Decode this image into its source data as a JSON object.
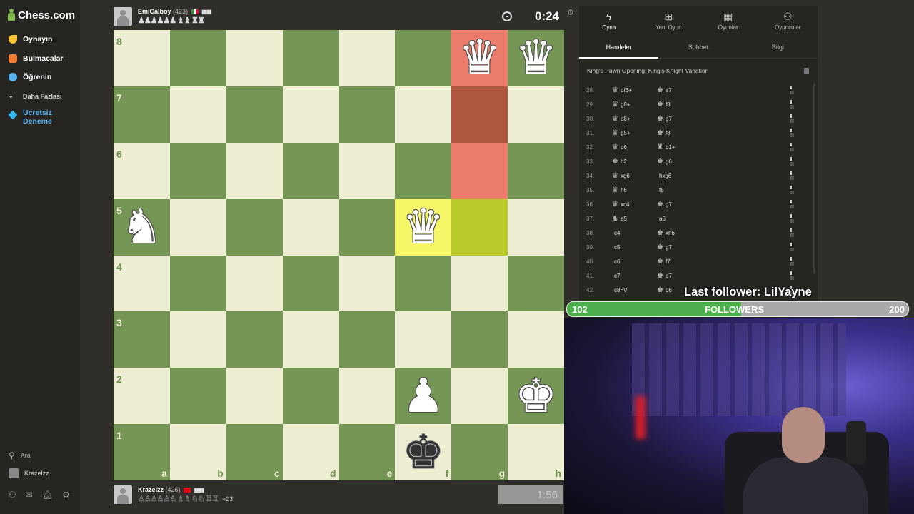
{
  "sidebar": {
    "logo": "Chess.com",
    "items": [
      {
        "label": "Oynayın",
        "icon": "play-icon",
        "color": "#f7c631"
      },
      {
        "label": "Bulmacalar",
        "icon": "puzzle-icon",
        "color": "#f17f36"
      },
      {
        "label": "Öğrenin",
        "icon": "learn-icon",
        "color": "#5ab4f0"
      },
      {
        "label": "Daha Fazlası",
        "icon": "chevron-down-icon",
        "color": "#bbbbbb"
      }
    ],
    "trial_label": "Ücretsiz Deneme",
    "search_label": "Ara",
    "user_label": "Krazelzz"
  },
  "top_player": {
    "name": "EmiCalboy",
    "rating": "(423)",
    "captured": "♟♟♟♟♟♟ ♝♝ ♜♜",
    "clock": "0:24"
  },
  "bottom_player": {
    "name": "Krazelzz",
    "rating": "(426)",
    "captured": "♙♙♙♙♙♙ ♗♗ ♘♘ ♖♖",
    "advantage": "+23",
    "clock": "1:56"
  },
  "board": {
    "files": [
      "a",
      "b",
      "c",
      "d",
      "e",
      "f",
      "g",
      "h"
    ],
    "ranks": [
      "8",
      "7",
      "6",
      "5",
      "4",
      "3",
      "2",
      "1"
    ],
    "highlight_colors": {
      "check": "#eb7b6a",
      "check_dark": "#b0573f",
      "last_move": "#f6f669",
      "last_move_dark": "#bbcb2b"
    },
    "pieces": [
      {
        "square": "g8",
        "glyph": "♛",
        "side": "white",
        "name": "white-queen"
      },
      {
        "square": "h8",
        "glyph": "♛",
        "side": "white",
        "name": "white-queen"
      },
      {
        "square": "a5",
        "glyph": "♞",
        "side": "white",
        "name": "white-knight"
      },
      {
        "square": "f5",
        "glyph": "♛",
        "side": "white",
        "name": "white-queen"
      },
      {
        "square": "f2",
        "glyph": "♟",
        "side": "white",
        "name": "white-pawn"
      },
      {
        "square": "h2",
        "glyph": "♚",
        "side": "white",
        "name": "white-king"
      },
      {
        "square": "f1",
        "glyph": "♚",
        "side": "black",
        "name": "black-king"
      }
    ],
    "highlights": [
      {
        "square": "g8",
        "type": "check"
      },
      {
        "square": "g7",
        "type": "check"
      },
      {
        "square": "g6",
        "type": "check"
      },
      {
        "square": "f5",
        "type": "last_move"
      },
      {
        "square": "g5",
        "type": "last_move"
      }
    ]
  },
  "panel": {
    "tabs": [
      {
        "label": "Oyna",
        "icon": "lightning-icon"
      },
      {
        "label": "Yeni Oyun",
        "icon": "plus-square-icon"
      },
      {
        "label": "Oyunlar",
        "icon": "board-icon"
      },
      {
        "label": "Oyuncular",
        "icon": "players-icon"
      }
    ],
    "subtabs": [
      "Hamleler",
      "Sohbet",
      "Bilgi"
    ],
    "opening": "King's Pawn Opening: King's Knight Variation",
    "moves": [
      {
        "num": "28.",
        "w_piece": "♛",
        "w": "df6+",
        "b_piece": "♚",
        "b": "e7"
      },
      {
        "num": "29.",
        "w_piece": "♛",
        "w": "g8+",
        "b_piece": "♚",
        "b": "f8"
      },
      {
        "num": "30.",
        "w_piece": "♛",
        "w": "d8+",
        "b_piece": "♚",
        "b": "g7"
      },
      {
        "num": "31.",
        "w_piece": "♛",
        "w": "g5+",
        "b_piece": "♚",
        "b": "f8"
      },
      {
        "num": "32.",
        "w_piece": "♛",
        "w": "d6",
        "b_piece": "♜",
        "b": "b1+"
      },
      {
        "num": "33.",
        "w_piece": "♚",
        "w": "h2",
        "b_piece": "♚",
        "b": "g6"
      },
      {
        "num": "34.",
        "w_piece": "♛",
        "w": "xg6",
        "b_piece": "",
        "b": "hxg6"
      },
      {
        "num": "35.",
        "w_piece": "♛",
        "w": "h6",
        "b_piece": "",
        "b": "f5"
      },
      {
        "num": "36.",
        "w_piece": "♛",
        "w": "xc4",
        "b_piece": "♚",
        "b": "g7"
      },
      {
        "num": "37.",
        "w_piece": "♞",
        "w": "a5",
        "b_piece": "",
        "b": "a6"
      },
      {
        "num": "38.",
        "w_piece": "",
        "w": "c4",
        "b_piece": "♚",
        "b": "xh6"
      },
      {
        "num": "39.",
        "w_piece": "",
        "w": "c5",
        "b_piece": "♚",
        "b": "g7"
      },
      {
        "num": "40.",
        "w_piece": "",
        "w": "c6",
        "b_piece": "♚",
        "b": "f7"
      },
      {
        "num": "41.",
        "w_piece": "",
        "w": "c7",
        "b_piece": "♚",
        "b": "e7"
      },
      {
        "num": "42.",
        "w_piece": "",
        "w": "c8=V",
        "b_piece": "♚",
        "b": "d6"
      }
    ]
  },
  "overlay": {
    "last_follower": "Last follower: LilYayne",
    "followers_current": "102",
    "followers_label": "FOLLOWERS",
    "followers_goal": "200",
    "progress_fraction": 0.51
  }
}
